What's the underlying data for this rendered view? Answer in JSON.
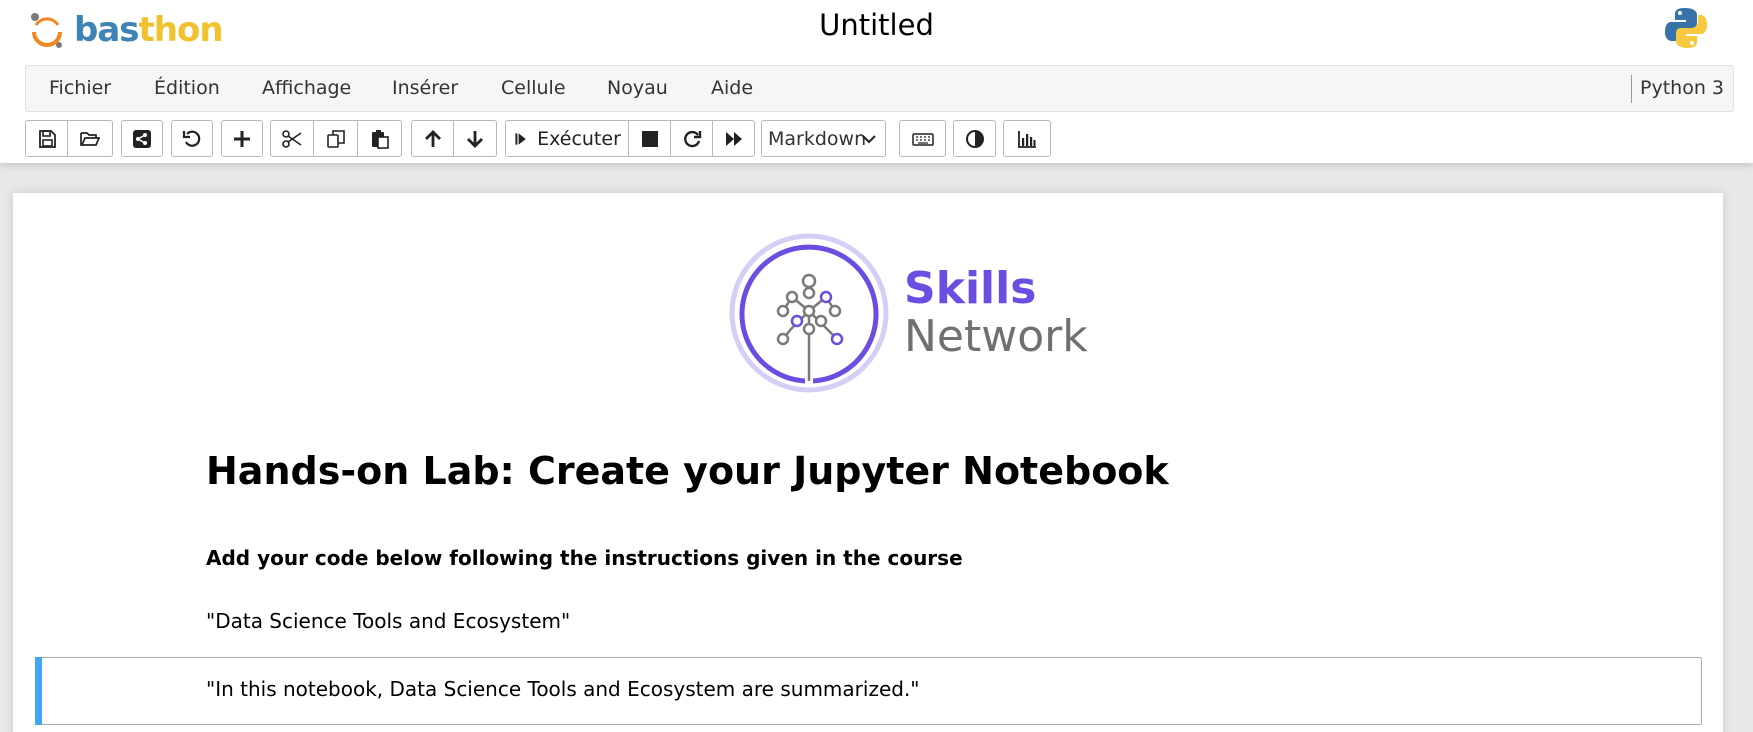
{
  "app": {
    "logo_bas": "bas",
    "logo_thon": "thon",
    "notebook_title": "Untitled"
  },
  "menubar": {
    "items": [
      "Fichier",
      "Édition",
      "Affichage",
      "Insérer",
      "Cellule",
      "Noyau",
      "Aide"
    ],
    "kernel": "Python 3"
  },
  "toolbar": {
    "buttons": [
      {
        "icon": "save-icon"
      },
      {
        "icon": "folder-open-icon"
      },
      {
        "icon": "share-icon"
      },
      {
        "icon": "undo-icon"
      },
      {
        "icon": "plus-icon"
      },
      {
        "icon": "scissors-icon"
      },
      {
        "icon": "copy-icon"
      },
      {
        "icon": "paste-icon"
      },
      {
        "icon": "arrow-up-icon"
      },
      {
        "icon": "arrow-down-icon"
      },
      {
        "icon": "step-forward-icon"
      },
      {
        "icon": "stop-icon"
      },
      {
        "icon": "restart-icon"
      },
      {
        "icon": "fast-forward-icon"
      },
      {
        "icon": "keyboard-icon"
      },
      {
        "icon": "contrast-icon"
      },
      {
        "icon": "bar-chart-icon"
      }
    ],
    "run_label": "Exécuter",
    "cell_type": "Markdown"
  },
  "notebook": {
    "logo_skills": "Skills",
    "logo_network": "Network",
    "heading": "Hands-on Lab: Create your Jupyter Notebook",
    "subheading": "Add your code below following the instructions given in the course",
    "quote1": "\"Data Science Tools and Ecosystem\"",
    "quote2": "\"In this notebook, Data Science Tools and Ecosystem are summarized.\""
  },
  "colors": {
    "accent": "#42a5f5",
    "skills": "#6c4de2",
    "logo_bas": "#3e83b5",
    "logo_thon": "#f2c12e"
  }
}
